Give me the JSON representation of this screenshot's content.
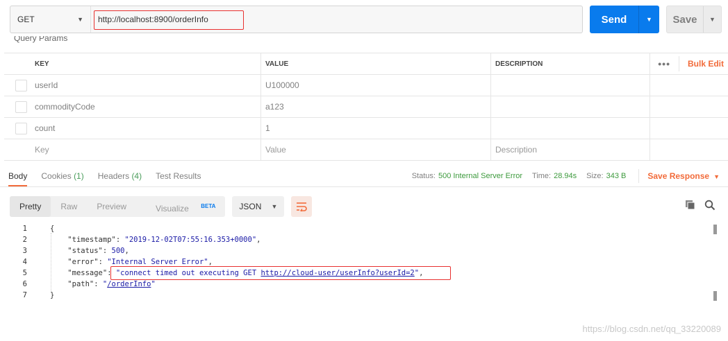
{
  "request": {
    "method": "GET",
    "url": "http://localhost:8900/orderInfo",
    "send_label": "Send",
    "save_label": "Save"
  },
  "query_params_label": "Query Params",
  "params_table": {
    "headers": {
      "key": "KEY",
      "value": "VALUE",
      "description": "DESCRIPTION",
      "bulk_edit": "Bulk Edit"
    },
    "rows": [
      {
        "key": "userId",
        "value": "U100000",
        "description": ""
      },
      {
        "key": "commodityCode",
        "value": "a123",
        "description": ""
      },
      {
        "key": "count",
        "value": "1",
        "description": ""
      }
    ],
    "placeholders": {
      "key": "Key",
      "value": "Value",
      "description": "Description"
    }
  },
  "response_tabs": {
    "body": "Body",
    "cookies": "Cookies",
    "cookies_count": "(1)",
    "headers": "Headers",
    "headers_count": "(4)",
    "test_results": "Test Results"
  },
  "status": {
    "status_label": "Status:",
    "status_value": "500 Internal Server Error",
    "time_label": "Time:",
    "time_value": "28.94s",
    "size_label": "Size:",
    "size_value": "343 B",
    "save_response": "Save Response"
  },
  "view_modes": {
    "pretty": "Pretty",
    "raw": "Raw",
    "preview": "Preview",
    "visualize": "Visualize",
    "beta": "BETA",
    "format": "JSON"
  },
  "code_lines": {
    "l1": "{",
    "l2_key": "\"timestamp\"",
    "l2_val": "\"2019-12-02T07:55:16.353+0000\"",
    "l3_key": "\"status\"",
    "l3_val": "500",
    "l4_key": "\"error\"",
    "l4_val": "\"Internal Server Error\"",
    "l5_key": "\"message\"",
    "l5_val_a": "\"connect timed out executing GET ",
    "l5_link": "http://cloud-user/userInfo?userId=2",
    "l5_val_b": "\"",
    "l6_key": "\"path\"",
    "l6_val_a": "\"",
    "l6_link": "/orderInfo",
    "l6_val_b": "\"",
    "l7": "}"
  },
  "line_numbers": [
    "1",
    "2",
    "3",
    "4",
    "5",
    "6",
    "7"
  ],
  "watermark": "https://blog.csdn.net/qq_33220089",
  "colors": {
    "accent_orange": "#f26b3a",
    "send_blue": "#097bed",
    "status_green": "#3d9a3d",
    "highlight_red": "#e8302f"
  }
}
